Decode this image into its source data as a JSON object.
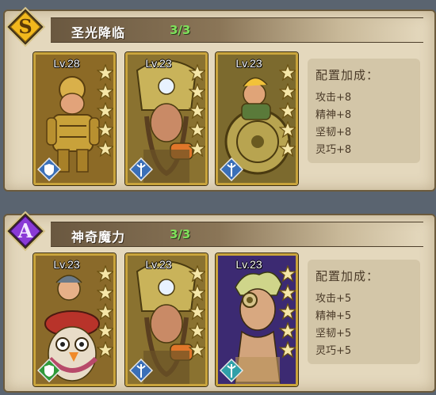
{
  "sets": [
    {
      "rank": "S",
      "rank_color": "#f2b81d",
      "name": "圣光降临",
      "count": "3/3",
      "bonus_title": "配置加成：",
      "bonuses": [
        "攻击+8",
        "精神+8",
        "坚韧+8",
        "灵巧+8"
      ],
      "heroes": [
        {
          "level": "Lv.28",
          "stars": 5,
          "frame": "gold",
          "class_icon": "shield-icon",
          "class_color": "#3a6fb8"
        },
        {
          "level": "Lv.23",
          "stars": 5,
          "frame": "gold",
          "class_icon": "staff-icon",
          "class_color": "#3a6fb8"
        },
        {
          "level": "Lv.23",
          "stars": 5,
          "frame": "gold",
          "class_icon": "staff-icon",
          "class_color": "#3a6fb8"
        }
      ]
    },
    {
      "rank": "A",
      "rank_color": "#8a3ad6",
      "name": "神奇魔力",
      "count": "3/3",
      "bonus_title": "配置加成：",
      "bonuses": [
        "攻击+5",
        "精神+5",
        "坚韧+5",
        "灵巧+5"
      ],
      "heroes": [
        {
          "level": "Lv.23",
          "stars": 5,
          "frame": "gold",
          "class_icon": "shield-icon",
          "class_color": "#2f9a3a"
        },
        {
          "level": "Lv.23",
          "stars": 5,
          "frame": "gold",
          "class_icon": "staff-icon",
          "class_color": "#3a6fb8"
        },
        {
          "level": "Lv.23",
          "stars": 5,
          "frame": "purple",
          "class_icon": "staff-icon",
          "class_color": "#2fa0a8"
        }
      ]
    }
  ]
}
